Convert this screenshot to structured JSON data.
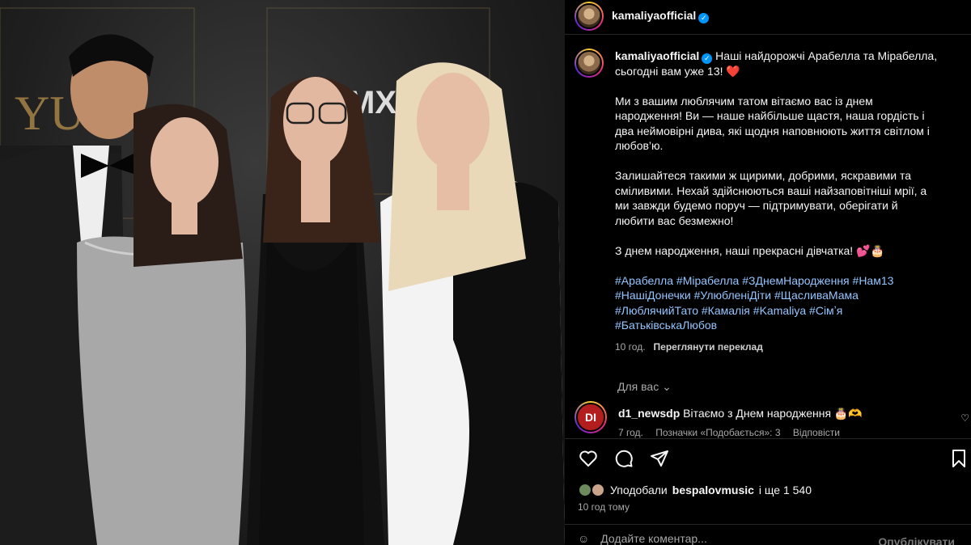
{
  "post": {
    "username": "kamaliyaofficial",
    "verified_mark": "✓"
  },
  "caption": {
    "username": "kamaliyaofficial",
    "line1": "Наші найдорожчі Арабелла та Мірабелла, сьогодні вам уже 13! ❤️",
    "para2": "Ми з вашим люблячим татом вітаємо вас із днем народження! Ви — наше найбільше щастя, наша гордість і два неймовірні дива, які щодня наповнюють життя світлом і любов’ю.",
    "para3": "Залишайтеся такими ж щирими, добрими, яскравими та сміливими. Нехай здійснюються ваші найзаповітніші мрії, а ми завжди будемо поруч — підтримувати, оберігати й любити вас безмежно!",
    "para4": "З днем народження, наші прекрасні дівчатка! 💕🎂",
    "hashtags": [
      "#Арабелла",
      "#Мірабелла",
      "#ЗДнемНародження",
      "#Нам13",
      "#НашіДонечки",
      "#УлюбленіДіти",
      "#ЩасливаМама",
      "#ЛюблячийТато",
      "#Камалія",
      "#Kamaliya",
      "#Сімʼя",
      "#БатьківськаЛюбов"
    ],
    "time": "10 год.",
    "translate": "Переглянути переклад"
  },
  "for_you": "Для вас",
  "comment": {
    "avatar_text": "DI",
    "username": "d1_newsdp",
    "text": "Вітаємо з Днем народження 🎂🫶",
    "time": "7 год.",
    "likes": "Позначки «Подобається»: 3",
    "reply": "Відповісти"
  },
  "likes": {
    "prefix": "Уподобали",
    "user": "bespalovmusic",
    "suffix": "і ще 1 540"
  },
  "ago": "10 год тому",
  "add_comment": {
    "placeholder": "Додайте коментар...",
    "post": "Опублікувати"
  },
  "icons": [
    "heart-icon",
    "comment-icon",
    "share-icon",
    "bookmark-icon",
    "emoji-icon"
  ]
}
